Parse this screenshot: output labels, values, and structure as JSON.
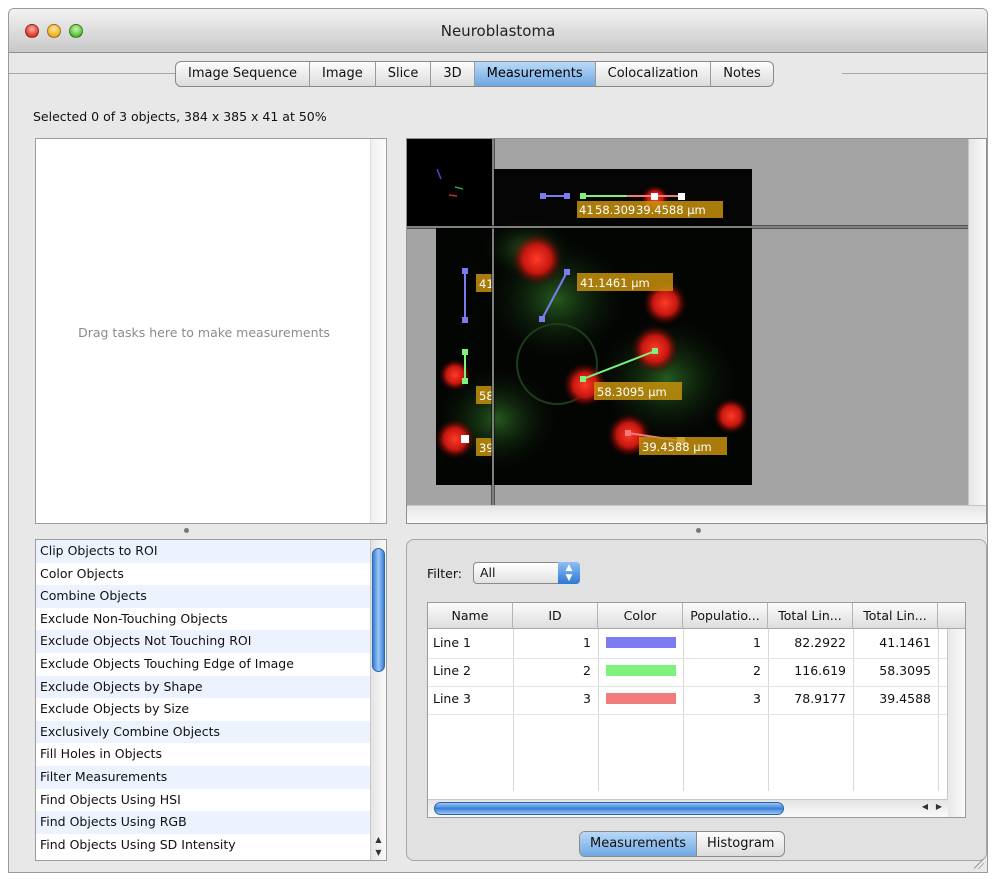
{
  "window": {
    "title": "Neuroblastoma"
  },
  "tabs": [
    {
      "label": "Image Sequence",
      "selected": false
    },
    {
      "label": "Image",
      "selected": false
    },
    {
      "label": "Slice",
      "selected": false
    },
    {
      "label": "3D",
      "selected": false
    },
    {
      "label": "Measurements",
      "selected": true
    },
    {
      "label": "Colocalization",
      "selected": false
    },
    {
      "label": "Notes",
      "selected": false
    }
  ],
  "status": "Selected 0 of 3 objects, 384 x 385 x 41 at 50%",
  "task_drop": {
    "placeholder": "Drag tasks here to make measurements"
  },
  "task_list": [
    "Clip Objects to ROI",
    "Color Objects",
    "Combine Objects",
    "Exclude Non-Touching Objects",
    "Exclude Objects Not Touching ROI",
    "Exclude Objects Touching Edge of Image",
    "Exclude Objects by Shape",
    "Exclude Objects by Size",
    "Exclusively Combine Objects",
    "Fill Holes in Objects",
    "Filter Measurements",
    "Find Objects Using HSI",
    "Find Objects Using RGB",
    "Find Objects Using SD Intensity"
  ],
  "viewer": {
    "labels": {
      "top_strip": "41.58.30939.4588 µm",
      "top_strip_a": "41",
      "top_strip_b": "58.309",
      "top_strip_c": "39.4588 µm",
      "side_1": "41",
      "side_2": "58",
      "side_3": "39",
      "line_1": "41.1461 µm",
      "line_2": "58.3095 µm",
      "line_3": "39.4588 µm"
    }
  },
  "measurements": {
    "filter_label": "Filter:",
    "filter_value": "All",
    "columns": [
      "Name",
      "ID",
      "Color",
      "Populatio...",
      "Total Lin...",
      "Total Lin..."
    ],
    "rows": [
      {
        "name": "Line 1",
        "id": "1",
        "color": "#7b7cf2",
        "population": "1",
        "total1": "82.2922",
        "total2": "41.1461"
      },
      {
        "name": "Line 2",
        "id": "2",
        "color": "#7ef27b",
        "population": "2",
        "total1": "116.619",
        "total2": "58.3095"
      },
      {
        "name": "Line 3",
        "id": "3",
        "color": "#f27b7b",
        "population": "3",
        "total1": "78.9177",
        "total2": "39.4588"
      }
    ],
    "segments": [
      {
        "label": "Measurements",
        "selected": true
      },
      {
        "label": "Histogram",
        "selected": false
      }
    ]
  }
}
